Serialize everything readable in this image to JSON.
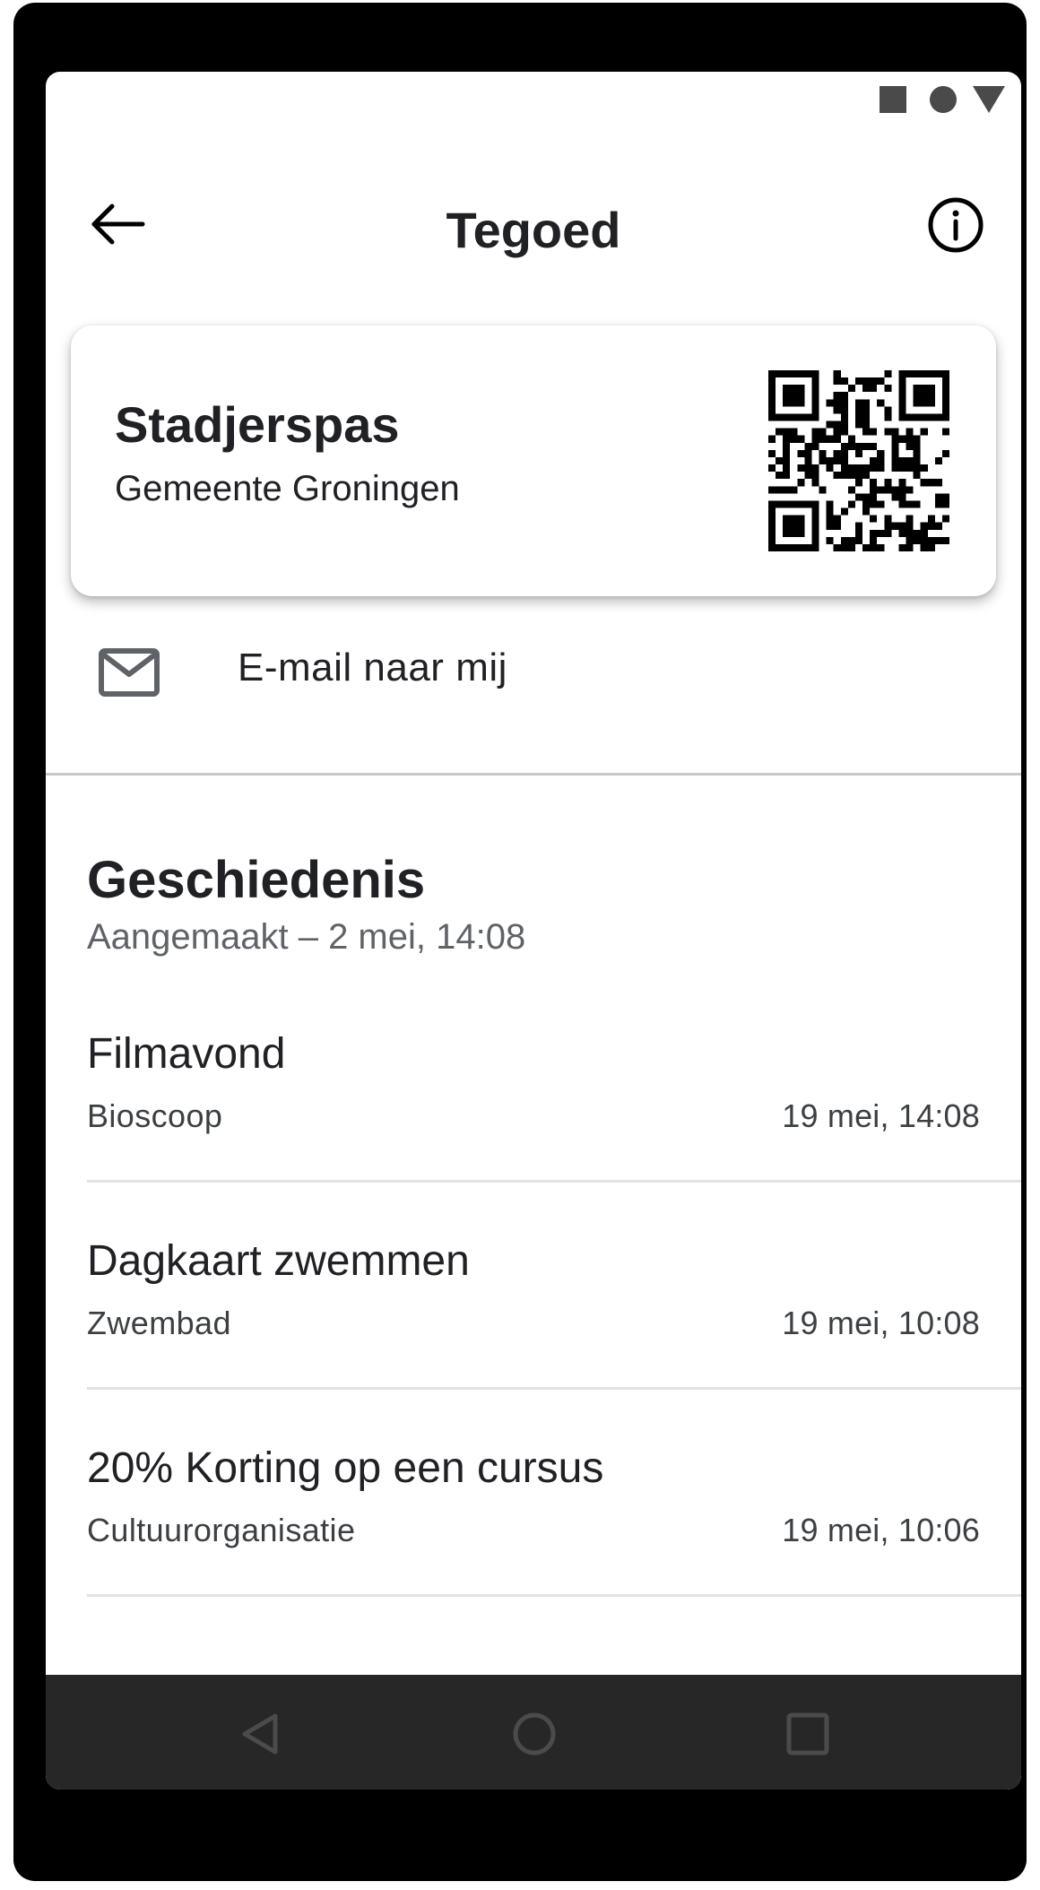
{
  "status_bar": {
    "icons": [
      "square-icon",
      "circle-icon",
      "triangle-icon"
    ]
  },
  "app_bar": {
    "title": "Tegoed",
    "back_icon": "arrow-left-icon",
    "info_icon": "info-icon"
  },
  "pass_card": {
    "title": "Stadjerspas",
    "subtitle": "Gemeente Groningen",
    "qr_icon": "qr-code"
  },
  "email_action": {
    "icon": "mail-icon",
    "label": "E-mail naar mij"
  },
  "history": {
    "title": "Geschiedenis",
    "subtitle": "Aangemaakt – 2 mei, 14:08",
    "items": [
      {
        "title": "Filmavond",
        "location": "Bioscoop",
        "time": "19 mei, 14:08"
      },
      {
        "title": "Dagkaart zwemmen",
        "location": "Zwembad",
        "time": "19 mei, 10:08"
      },
      {
        "title": "20% Korting op een cursus",
        "location": "Cultuurorganisatie",
        "time": "19 mei, 10:06"
      }
    ]
  },
  "nav_bar": {
    "icons": [
      "nav-back-icon",
      "nav-home-icon",
      "nav-recents-icon"
    ]
  },
  "colors": {
    "text_primary": "#202124",
    "text_secondary": "#5f6368",
    "nav_bar": "#272727",
    "device_frame": "#000000"
  }
}
